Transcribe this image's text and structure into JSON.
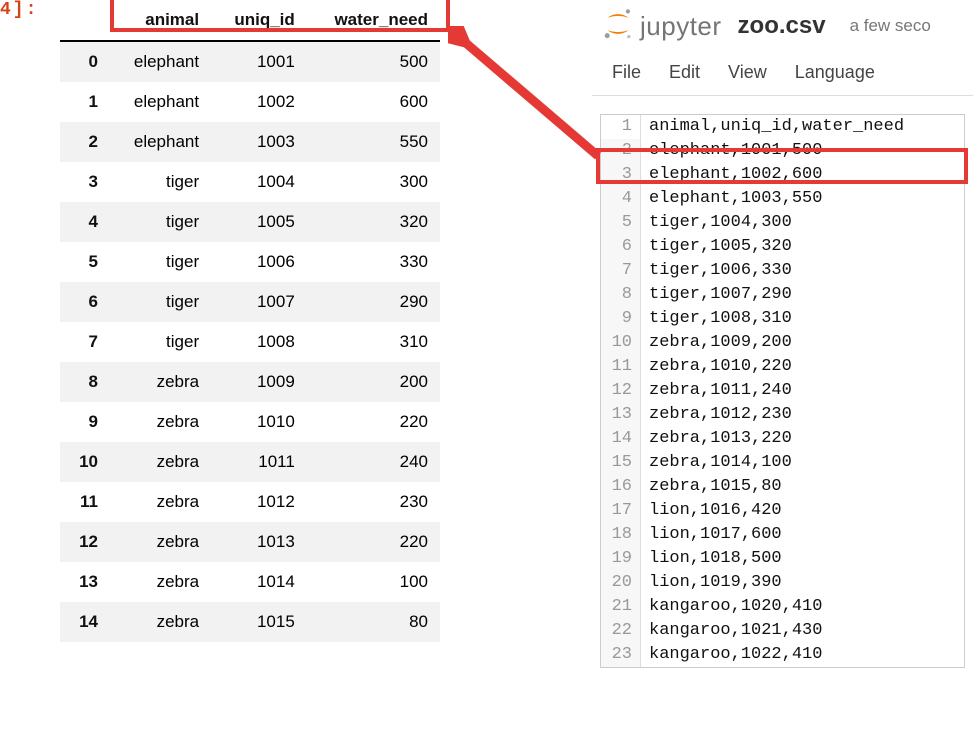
{
  "cell_prompt": "4]:",
  "dataframe": {
    "columns": [
      "animal",
      "uniq_id",
      "water_need"
    ],
    "rows": [
      {
        "idx": "0",
        "animal": "elephant",
        "uniq_id": "1001",
        "water_need": "500"
      },
      {
        "idx": "1",
        "animal": "elephant",
        "uniq_id": "1002",
        "water_need": "600"
      },
      {
        "idx": "2",
        "animal": "elephant",
        "uniq_id": "1003",
        "water_need": "550"
      },
      {
        "idx": "3",
        "animal": "tiger",
        "uniq_id": "1004",
        "water_need": "300"
      },
      {
        "idx": "4",
        "animal": "tiger",
        "uniq_id": "1005",
        "water_need": "320"
      },
      {
        "idx": "5",
        "animal": "tiger",
        "uniq_id": "1006",
        "water_need": "330"
      },
      {
        "idx": "6",
        "animal": "tiger",
        "uniq_id": "1007",
        "water_need": "290"
      },
      {
        "idx": "7",
        "animal": "tiger",
        "uniq_id": "1008",
        "water_need": "310"
      },
      {
        "idx": "8",
        "animal": "zebra",
        "uniq_id": "1009",
        "water_need": "200"
      },
      {
        "idx": "9",
        "animal": "zebra",
        "uniq_id": "1010",
        "water_need": "220"
      },
      {
        "idx": "10",
        "animal": "zebra",
        "uniq_id": "1011",
        "water_need": "240"
      },
      {
        "idx": "11",
        "animal": "zebra",
        "uniq_id": "1012",
        "water_need": "230"
      },
      {
        "idx": "12",
        "animal": "zebra",
        "uniq_id": "1013",
        "water_need": "220"
      },
      {
        "idx": "13",
        "animal": "zebra",
        "uniq_id": "1014",
        "water_need": "100"
      },
      {
        "idx": "14",
        "animal": "zebra",
        "uniq_id": "1015",
        "water_need": "80"
      }
    ]
  },
  "jupyter": {
    "brand": "jupyter",
    "filename": "zoo.csv",
    "saved": "a few seco",
    "menu": {
      "file": "File",
      "edit": "Edit",
      "view": "View",
      "language": "Language"
    },
    "lines": [
      {
        "n": "1",
        "t": "animal,uniq_id,water_need"
      },
      {
        "n": "2",
        "t": "elephant,1001,500"
      },
      {
        "n": "3",
        "t": "elephant,1002,600"
      },
      {
        "n": "4",
        "t": "elephant,1003,550"
      },
      {
        "n": "5",
        "t": "tiger,1004,300"
      },
      {
        "n": "6",
        "t": "tiger,1005,320"
      },
      {
        "n": "7",
        "t": "tiger,1006,330"
      },
      {
        "n": "8",
        "t": "tiger,1007,290"
      },
      {
        "n": "9",
        "t": "tiger,1008,310"
      },
      {
        "n": "10",
        "t": "zebra,1009,200"
      },
      {
        "n": "11",
        "t": "zebra,1010,220"
      },
      {
        "n": "12",
        "t": "zebra,1011,240"
      },
      {
        "n": "13",
        "t": "zebra,1012,230"
      },
      {
        "n": "14",
        "t": "zebra,1013,220"
      },
      {
        "n": "15",
        "t": "zebra,1014,100"
      },
      {
        "n": "16",
        "t": "zebra,1015,80"
      },
      {
        "n": "17",
        "t": "lion,1016,420"
      },
      {
        "n": "18",
        "t": "lion,1017,600"
      },
      {
        "n": "19",
        "t": "lion,1018,500"
      },
      {
        "n": "20",
        "t": "lion,1019,390"
      },
      {
        "n": "21",
        "t": "kangaroo,1020,410"
      },
      {
        "n": "22",
        "t": "kangaroo,1021,430"
      },
      {
        "n": "23",
        "t": "kangaroo,1022,410"
      }
    ]
  },
  "colors": {
    "highlight": "#e53935",
    "arrow": "#e53935",
    "jupyter_orange": "#f57c00"
  }
}
